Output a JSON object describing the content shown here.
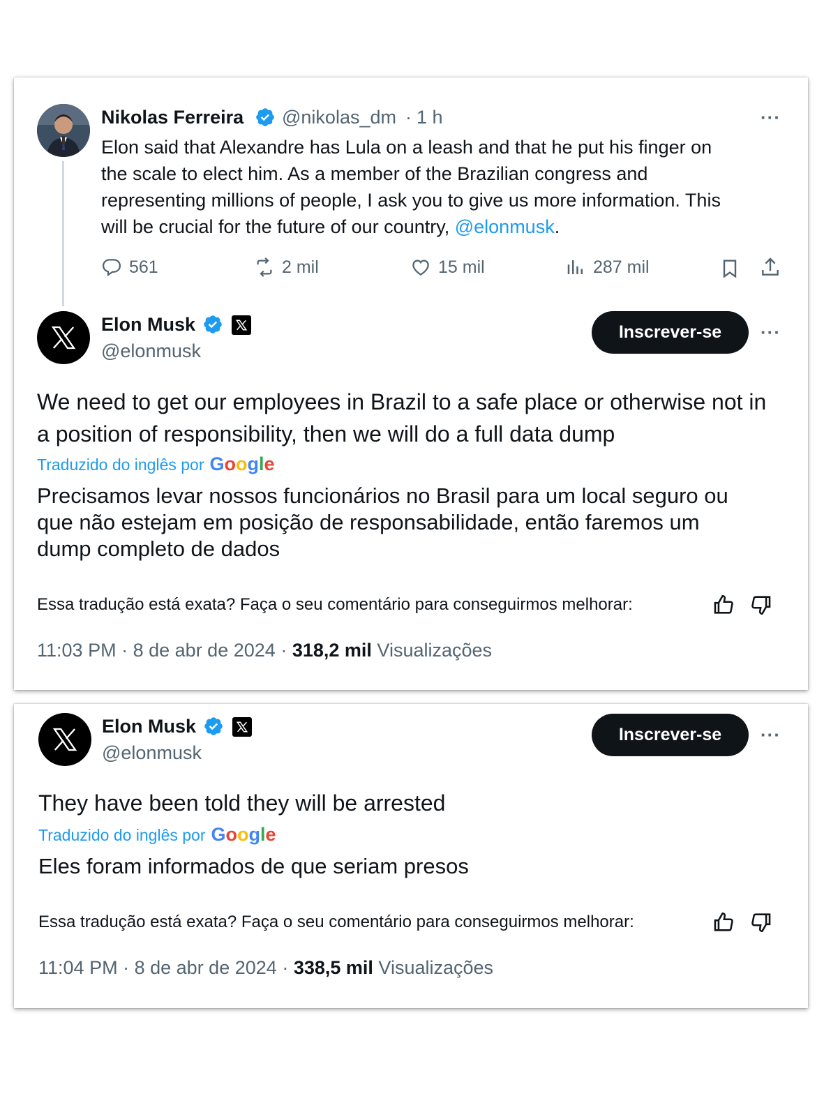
{
  "reply_tweet": {
    "name": "Nikolas Ferreira",
    "handle": "@nikolas_dm",
    "time_sep": "·",
    "time": "1 h",
    "text_lines": [
      "Elon said that Alexandre has Lula on a leash and that he put his finger on",
      "the scale to elect him. As a member of the Brazilian congress and",
      "representing millions of people, I ask you to give us more information. This"
    ],
    "text_last_prefix": "will be crucial for the future of our country, ",
    "mention": "@elonmusk",
    "text_last_suffix": ".",
    "replies": "561",
    "reposts": "2 mil",
    "likes": "15 mil",
    "views": "287 mil"
  },
  "tweet1": {
    "name": "Elon Musk",
    "handle": "@elonmusk",
    "subscribe_label": "Inscrever-se",
    "text_lines": [
      "We need to get our employees in Brazil to a safe place or otherwise not in",
      "a position of responsibility, then we will do a full data dump"
    ],
    "translated_by": "Traduzido do inglês por",
    "translation_lines": [
      "Precisamos levar nossos funcionários no Brasil para um local seguro ou",
      "que não estejam em posição de responsabilidade, então faremos um",
      "dump completo de dados"
    ],
    "feedback": "Essa tradução está exata? Faça o seu comentário para conseguirmos melhorar:",
    "time": "11:03 PM",
    "date": "8 de abr de 2024",
    "views_count": "318,2 mil",
    "views_label": "Visualizações"
  },
  "tweet2": {
    "name": "Elon Musk",
    "handle": "@elonmusk",
    "subscribe_label": "Inscrever-se",
    "text": "They have been told they will be arrested",
    "translated_by": "Traduzido do inglês por",
    "translation": "Eles foram informados de que seriam presos",
    "feedback": "Essa tradução está exata? Faça o seu comentário para conseguirmos melhorar:",
    "time": "11:04 PM",
    "date": "8 de abr de 2024",
    "views_count": "338,5 mil",
    "views_label": "Visualizações"
  },
  "common": {
    "google_logo": [
      "G",
      "o",
      "o",
      "g",
      "l",
      "e"
    ],
    "more_glyph": "···",
    "dot": "·"
  },
  "colors": {
    "accent": "#1d9bf0",
    "text": "#0f1419",
    "muted": "#536471"
  }
}
